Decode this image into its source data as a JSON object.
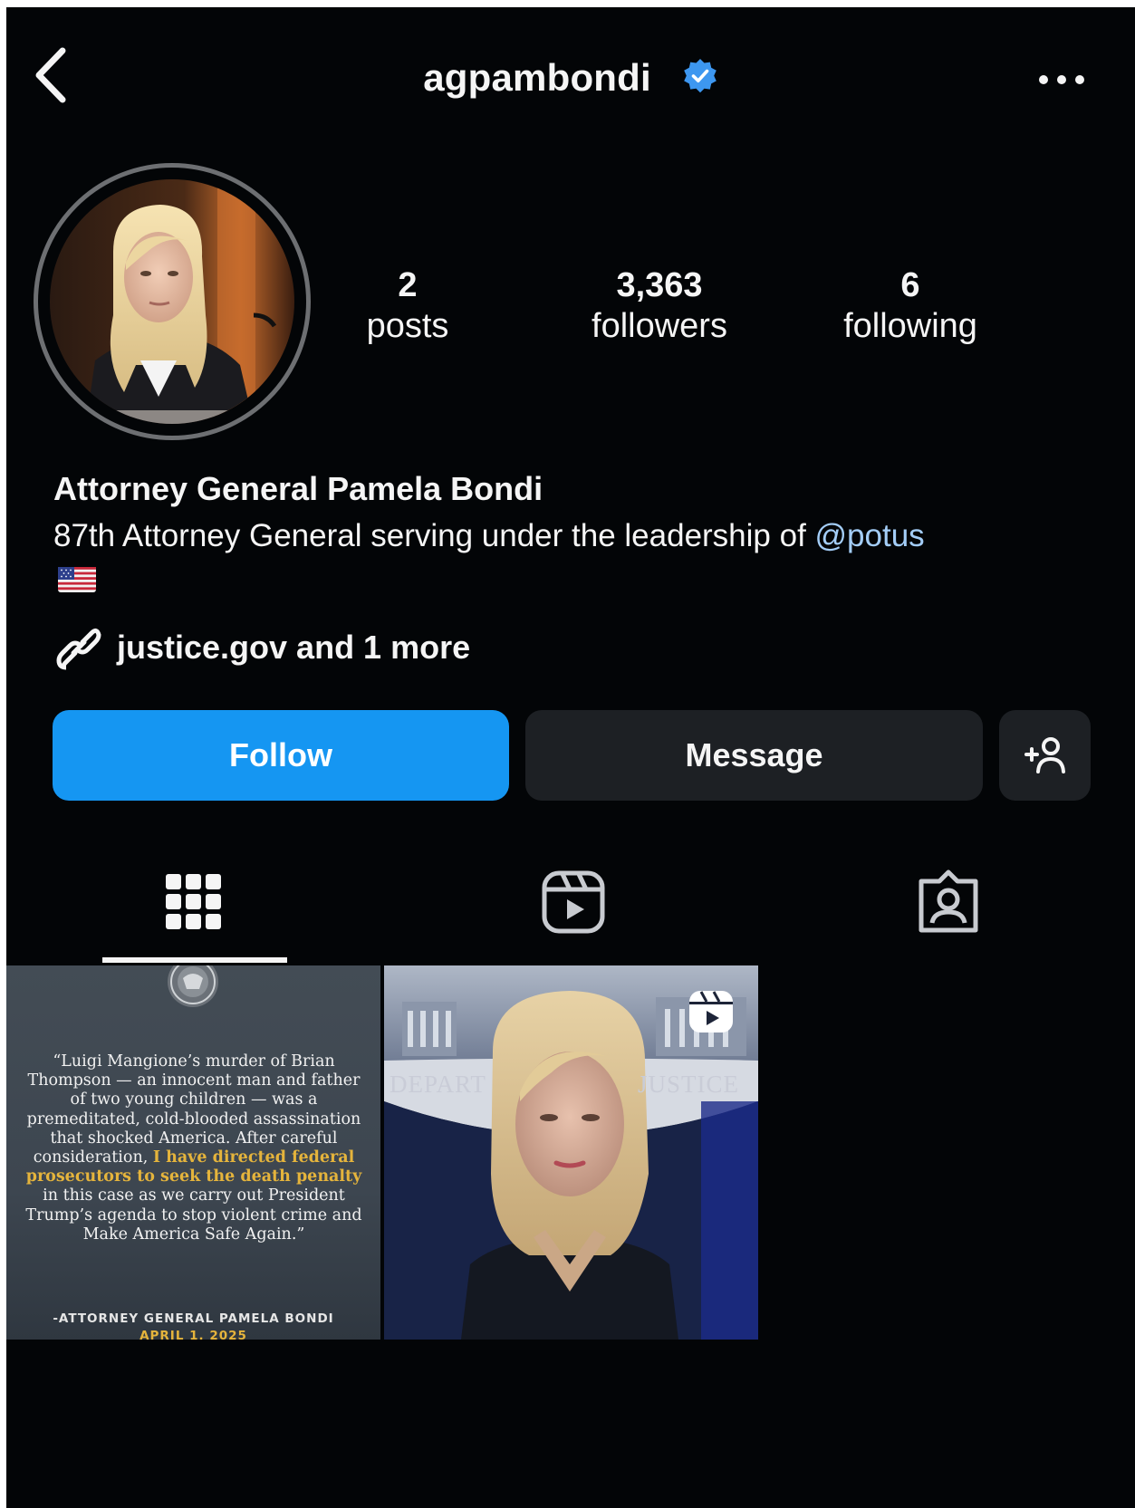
{
  "header": {
    "username": "agpambondi",
    "back_icon": "chevron-left-icon",
    "verified_icon": "verified-badge-icon",
    "more_icon": "more-horizontal-icon"
  },
  "stats": {
    "posts": {
      "value": "2",
      "label": "posts"
    },
    "followers": {
      "value": "3,363",
      "label": "followers"
    },
    "following": {
      "value": "6",
      "label": "following"
    }
  },
  "bio": {
    "name": "Attorney General Pamela Bondi",
    "text": "87th Attorney General serving under the leadership of ",
    "mention": "@potus",
    "flag_icon": "us-flag-icon",
    "link_icon": "link-icon",
    "link_text": "justice.gov and 1 more"
  },
  "buttons": {
    "follow": "Follow",
    "message": "Message",
    "add_user_icon": "add-user-icon"
  },
  "tabs": [
    {
      "icon": "grid-icon",
      "active": true
    },
    {
      "icon": "reels-icon",
      "active": false
    },
    {
      "icon": "tagged-icon",
      "active": false
    }
  ],
  "posts": [
    {
      "quote_part1": "“Luigi Mangione’s murder of Brian Thompson — an innocent man and father of two young children — was a premeditated, cold-blooded assassination that shocked America. After careful consideration, ",
      "quote_highlight": "I have directed federal prosecutors to seek the death penalty",
      "quote_part2": " in this case as we carry out President Trump’s agenda to stop violent crime and Make America Safe Again.”",
      "attribution": "-ATTORNEY GENERAL PAMELA BONDI",
      "date": "APRIL 1, 2025"
    },
    {
      "backdrop_left": "DEPART",
      "backdrop_right": "JUSTICE",
      "badge_icon": "reels-icon"
    }
  ],
  "colors": {
    "background": "#030507",
    "follow_button": "#1596f2",
    "secondary_button": "#1d2024",
    "mention": "#a3cdf7",
    "verified": "#3d97f0",
    "quote_highlight": "#e5b43c"
  }
}
